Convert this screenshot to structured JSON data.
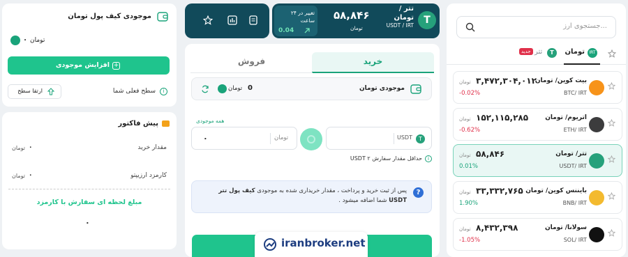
{
  "search": {
    "placeholder": "جستجوی ارز..."
  },
  "market_tabs": {
    "toman": "تومان",
    "tether": "تتر",
    "new_badge": "جدید"
  },
  "coins": [
    {
      "name": "بیت کوین/ تومان",
      "pair": "BTC/ IRT",
      "price": "۳,۴۷۲,۳۰۴,۰۱۲",
      "unit": "تومان",
      "change": "-0.02%",
      "change_dir": "down",
      "icon": "bitcoin-icon",
      "color": "#f7931a"
    },
    {
      "name": "اتریوم/ تومان",
      "pair": "ETH/ IRT",
      "price": "۱۵۲,۱۱۵,۲۸۵",
      "unit": "تومان",
      "change": "-0.62%",
      "change_dir": "down",
      "icon": "ethereum-icon",
      "color": "#3c3c3d"
    },
    {
      "name": "تتر/ تومان",
      "pair": "USDT/ IRT",
      "price": "۵۸,۸۴۶",
      "unit": "تومان",
      "change": "0.01%",
      "change_dir": "up",
      "icon": "tether-icon",
      "color": "#26a17b"
    },
    {
      "name": "بایننس کوین/ تومان",
      "pair": "BNB/ IRT",
      "price": "۳۳,۳۳۲,۷۶۵",
      "unit": "تومان",
      "change": "1.90%",
      "change_dir": "up",
      "icon": "bnb-icon",
      "color": "#f3ba2f"
    },
    {
      "name": "سولانا/ تومان",
      "pair": "SOL/ IRT",
      "price": "۸,۴۳۲,۳۹۸",
      "unit": "تومان",
      "change": "-1.05%",
      "change_dir": "down",
      "icon": "solana-icon",
      "color": "#111111"
    }
  ],
  "ticker": {
    "name": "تتر / تومان",
    "pair": "USDT / IRT",
    "price": "۵۸,۸۴۶",
    "price_unit": "تومان",
    "change_label": "تغییر در ۲۴ ساعت",
    "change_value": "0.04"
  },
  "trade": {
    "buy_tab": "خرید",
    "sell_tab": "فروش",
    "wallet_label": "موجودی تومان",
    "wallet_amount": "0",
    "wallet_unit": "تومان",
    "all_balance_link": "همه موجودی",
    "usdt_unit": "USDT",
    "toman_unit": "تومان",
    "toman_value": "۰",
    "min_order": "حداقل مقدار سفارش USDT ۲",
    "info_text_1": "پس از ثبت خرید و پرداخت ، مقدار خریداری شده به موجودی",
    "info_text_bold": "کیف پول تتر",
    "info_text_2": "USDT",
    "info_text_3": "شما اضافه میشود ."
  },
  "watermark": "iranbroker.net",
  "wallet_card": {
    "title": "موجودی کیف پول تومان",
    "amount": "۰",
    "unit": "تومان",
    "increase_button": "افزایش موجودی",
    "level_label": "سطح فعلی شما",
    "upgrade_button": "ارتقا سطح"
  },
  "invoice": {
    "title": "پیش فاکتور",
    "rows": [
      {
        "label": "مقدار خرید",
        "value": "۰",
        "unit": "تومان"
      },
      {
        "label": "کارمزد ارزیپتو",
        "value": "۰",
        "unit": "تومان"
      }
    ],
    "total_label": "مبلغ لحظه ای سفارش با کارمزد",
    "total_value": "۰"
  },
  "colors": {
    "brand": "#1fc48d",
    "dark": "#114a5a",
    "up": "#1aa37a",
    "down": "#e0304a"
  }
}
